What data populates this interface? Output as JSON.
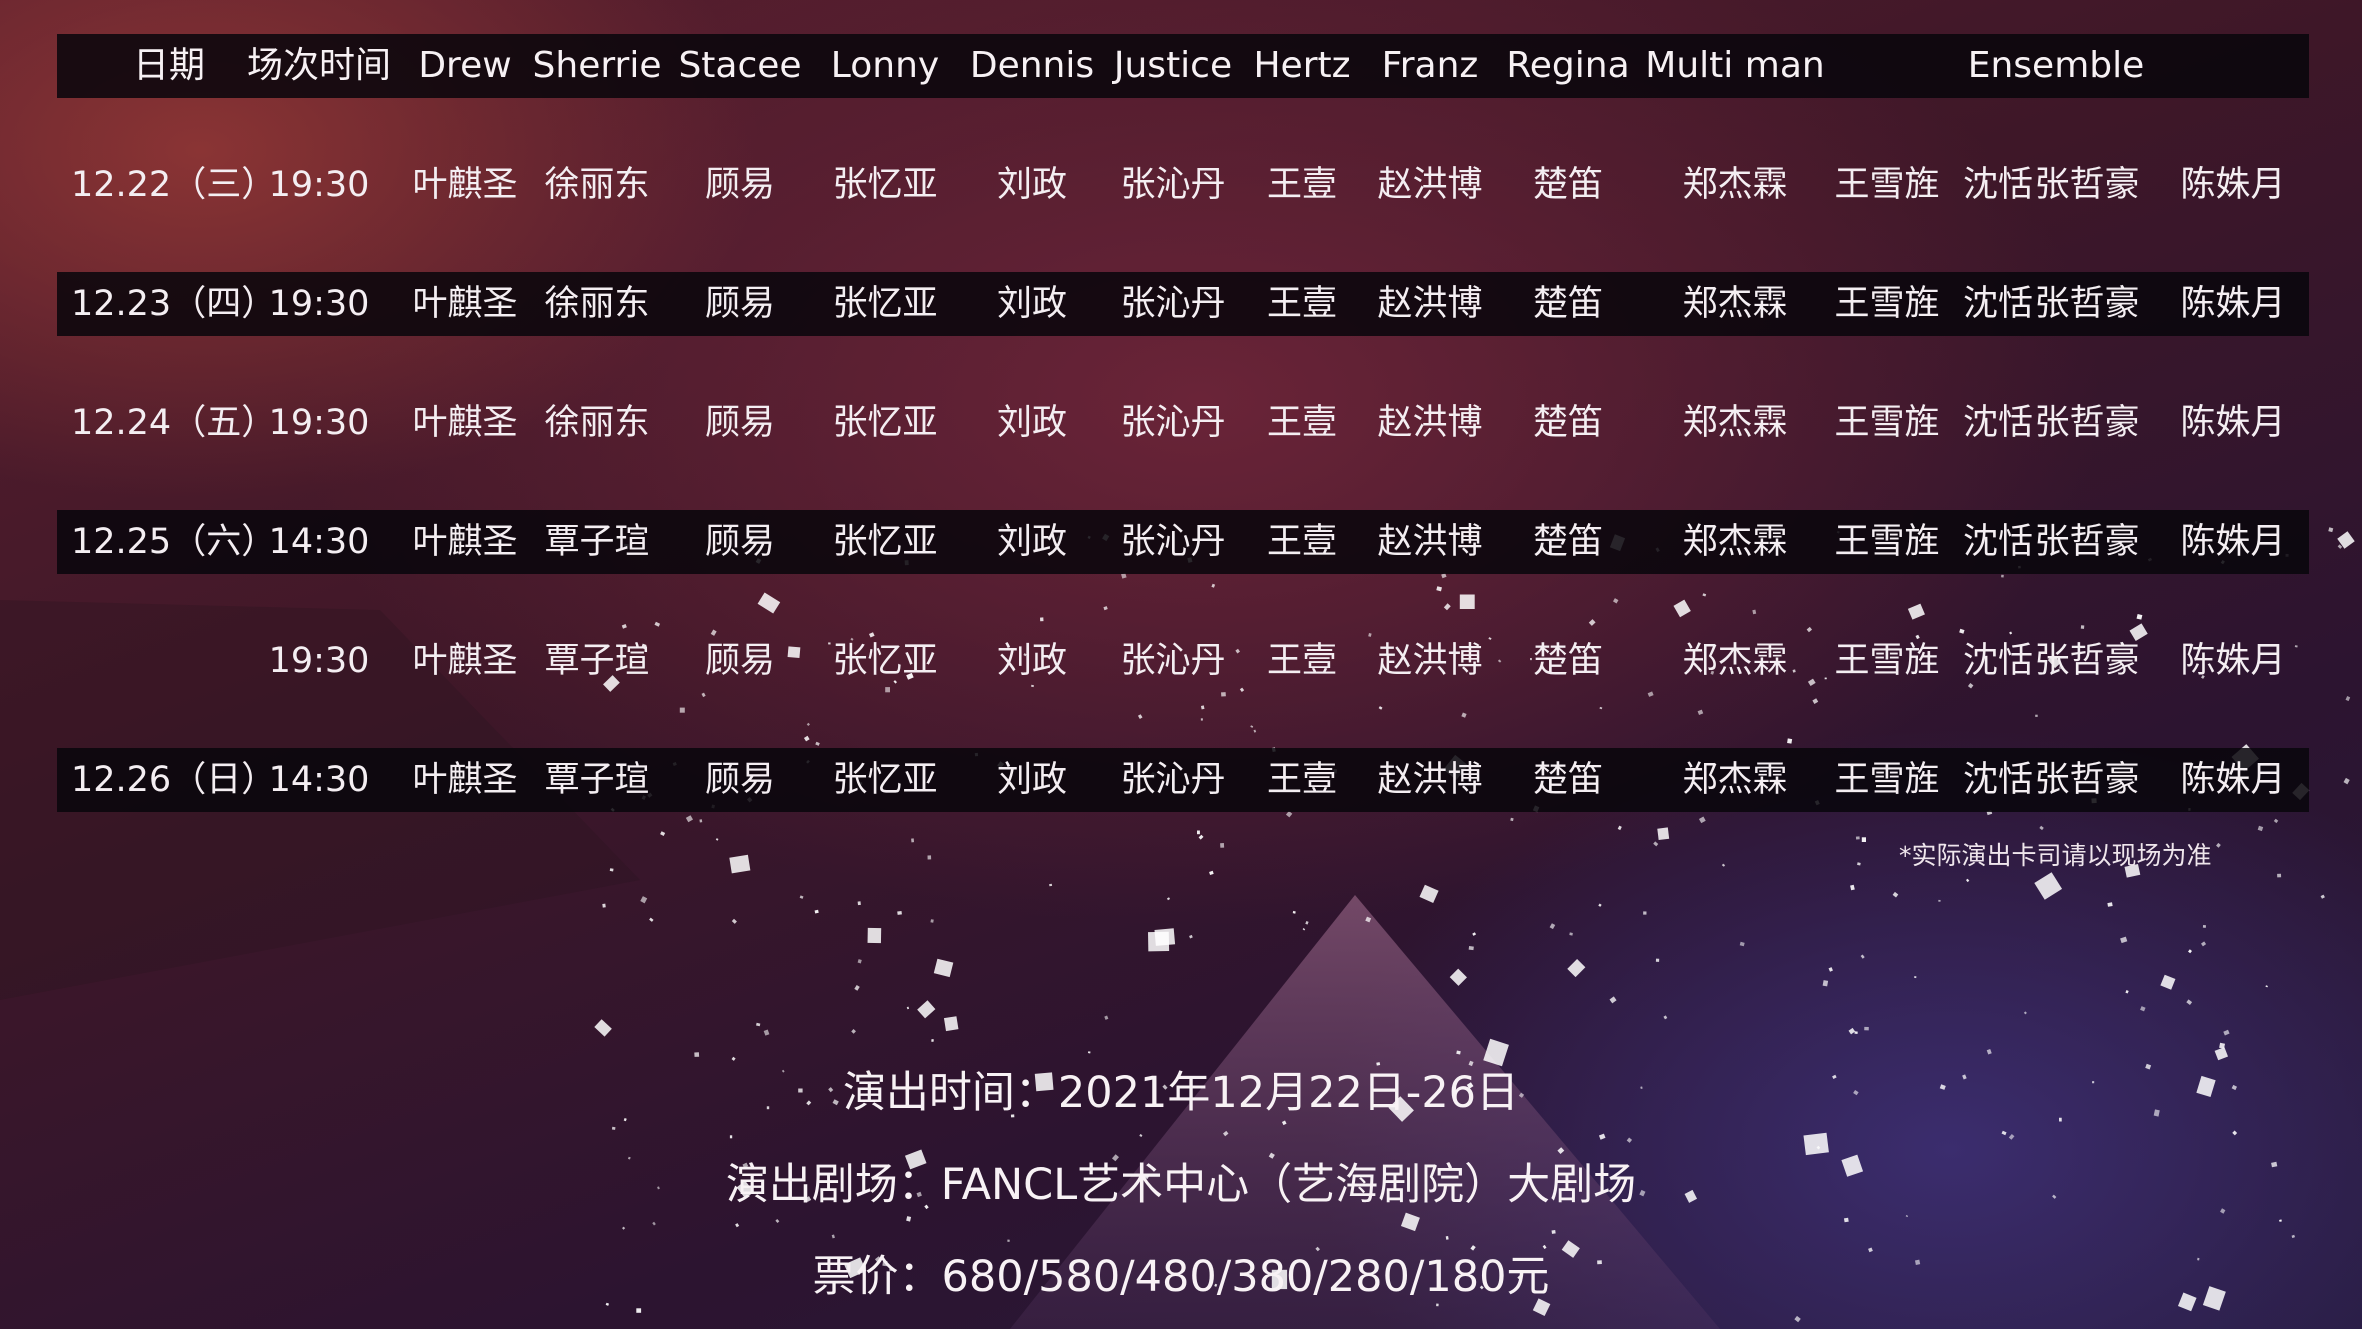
{
  "colors": {
    "band": "#08060c",
    "text": "#f4eef2",
    "bg_top": "#5a1f2e",
    "bg_bottom": "#261a3c"
  },
  "headers": [
    "日期",
    "场次时间",
    "Drew",
    "Sherrie",
    "Stacee",
    "Lonny",
    "Dennis",
    "Justice",
    "Hertz",
    "Franz",
    "Regina",
    "Multi man",
    "Ensemble"
  ],
  "rows": [
    {
      "date": "12.22（三）",
      "time": "19:30",
      "drew": "叶麒圣",
      "sherrie": "徐丽东",
      "stacee": "顾易",
      "lonny": "张忆亚",
      "dennis": "刘政",
      "justice": "张沁丹",
      "hertz": "王壹",
      "franz": "赵洪博",
      "regina": "楚笛",
      "multi": "郑杰霖",
      "ensemble": [
        "王雪旌",
        "沈恬",
        "张哲豪",
        "陈姝月"
      ]
    },
    {
      "date": "12.23（四）",
      "time": "19:30",
      "drew": "叶麒圣",
      "sherrie": "徐丽东",
      "stacee": "顾易",
      "lonny": "张忆亚",
      "dennis": "刘政",
      "justice": "张沁丹",
      "hertz": "王壹",
      "franz": "赵洪博",
      "regina": "楚笛",
      "multi": "郑杰霖",
      "ensemble": [
        "王雪旌",
        "沈恬",
        "张哲豪",
        "陈姝月"
      ]
    },
    {
      "date": "12.24（五）",
      "time": "19:30",
      "drew": "叶麒圣",
      "sherrie": "徐丽东",
      "stacee": "顾易",
      "lonny": "张忆亚",
      "dennis": "刘政",
      "justice": "张沁丹",
      "hertz": "王壹",
      "franz": "赵洪博",
      "regina": "楚笛",
      "multi": "郑杰霖",
      "ensemble": [
        "王雪旌",
        "沈恬",
        "张哲豪",
        "陈姝月"
      ]
    },
    {
      "date": "12.25（六）",
      "time": "14:30",
      "drew": "叶麒圣",
      "sherrie": "覃子瑄",
      "stacee": "顾易",
      "lonny": "张忆亚",
      "dennis": "刘政",
      "justice": "张沁丹",
      "hertz": "王壹",
      "franz": "赵洪博",
      "regina": "楚笛",
      "multi": "郑杰霖",
      "ensemble": [
        "王雪旌",
        "沈恬",
        "张哲豪",
        "陈姝月"
      ]
    },
    {
      "date": "",
      "time": "19:30",
      "drew": "叶麒圣",
      "sherrie": "覃子瑄",
      "stacee": "顾易",
      "lonny": "张忆亚",
      "dennis": "刘政",
      "justice": "张沁丹",
      "hertz": "王壹",
      "franz": "赵洪博",
      "regina": "楚笛",
      "multi": "郑杰霖",
      "ensemble": [
        "王雪旌",
        "沈恬",
        "张哲豪",
        "陈姝月"
      ]
    },
    {
      "date": "12.26（日）",
      "time": "14:30",
      "drew": "叶麒圣",
      "sherrie": "覃子瑄",
      "stacee": "顾易",
      "lonny": "张忆亚",
      "dennis": "刘政",
      "justice": "张沁丹",
      "hertz": "王壹",
      "franz": "赵洪博",
      "regina": "楚笛",
      "multi": "郑杰霖",
      "ensemble": [
        "王雪旌",
        "沈恬",
        "张哲豪",
        "陈姝月"
      ]
    }
  ],
  "note": "*实际演出卡司请以现场为准",
  "info": {
    "time": "演出时间：2021年12月22日-26日",
    "venue": "演出剧场：FANCL艺术中心（艺海剧院）大剧场",
    "price": "票价：680/580/480/380/280/180元"
  }
}
